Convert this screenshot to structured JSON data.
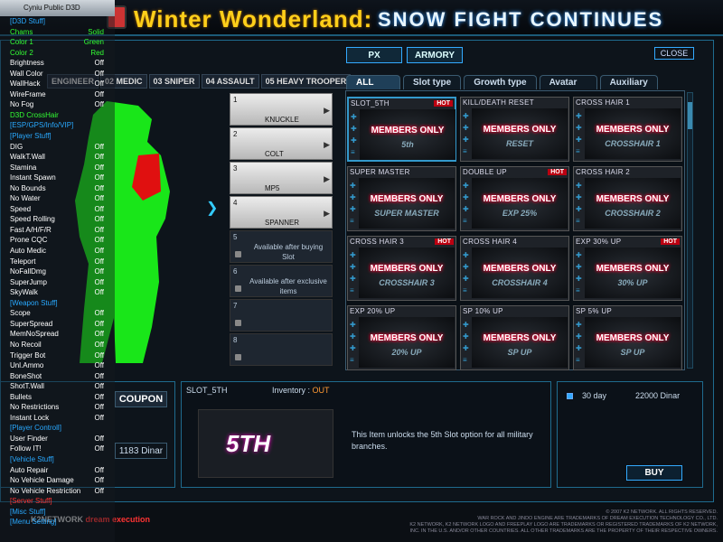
{
  "banner": {
    "title_part1": "Winter Wonderland:",
    "title_part2": "SNOW FIGHT CONTINUES"
  },
  "top": {
    "px": "PX",
    "armory": "ARMORY",
    "close": "CLOSE"
  },
  "class_tabs": [
    {
      "label": "ENGINEER"
    },
    {
      "label": "02 MEDIC"
    },
    {
      "label": "03 SNIPER"
    },
    {
      "label": "04 ASSAULT"
    },
    {
      "label": "05 HEAVY TROOPER"
    }
  ],
  "slots": [
    {
      "num": "1",
      "name": "KNUCKLE"
    },
    {
      "num": "2",
      "name": "COLT"
    },
    {
      "num": "3",
      "name": "MP5"
    },
    {
      "num": "4",
      "name": "SPANNER"
    },
    {
      "num": "5",
      "msg": "Available after buying Slot"
    },
    {
      "num": "6",
      "msg": "Available after exclusive items"
    },
    {
      "num": "7",
      "msg": ""
    },
    {
      "num": "8",
      "msg": ""
    }
  ],
  "cat_tabs": [
    "ALL",
    "Slot type",
    "Growth type",
    "Avatar",
    "Auxiliary"
  ],
  "items": [
    {
      "title": "SLOT_5TH",
      "hot": "HOT",
      "label": "MEMBERS ONLY",
      "sub": "5th"
    },
    {
      "title": "KILL/DEATH RESET",
      "hot": "",
      "label": "MEMBERS ONLY",
      "sub": "RESET"
    },
    {
      "title": "CROSS HAIR 1",
      "hot": "",
      "label": "MEMBERS ONLY",
      "sub": "CROSSHAIR 1"
    },
    {
      "title": "SUPER MASTER",
      "hot": "",
      "label": "MEMBERS ONLY",
      "sub": "SUPER MASTER"
    },
    {
      "title": "DOUBLE UP",
      "hot": "HOT",
      "label": "MEMBERS ONLY",
      "sub": "EXP 25%"
    },
    {
      "title": "CROSS HAIR 2",
      "hot": "",
      "label": "MEMBERS ONLY",
      "sub": "CROSSHAIR 2"
    },
    {
      "title": "CROSS HAIR 3",
      "hot": "HOT",
      "label": "MEMBERS ONLY",
      "sub": "CROSSHAIR 3"
    },
    {
      "title": "CROSS HAIR 4",
      "hot": "",
      "label": "MEMBERS ONLY",
      "sub": "CROSSHAIR 4"
    },
    {
      "title": "EXP 30% UP",
      "hot": "HOT",
      "label": "MEMBERS ONLY",
      "sub": "30% UP"
    },
    {
      "title": "EXP 20% UP",
      "hot": "",
      "label": "MEMBERS ONLY",
      "sub": "20% UP"
    },
    {
      "title": "SP 10% UP",
      "hot": "",
      "label": "MEMBERS ONLY",
      "sub": "SP UP"
    },
    {
      "title": "SP 5% UP",
      "hot": "",
      "label": "MEMBERS ONLY",
      "sub": "SP UP"
    }
  ],
  "bottom": {
    "coupon": "COUPON",
    "dinar": "1183 Dinar",
    "inventory_frag": "ENTORY"
  },
  "detail": {
    "name": "SLOT_5TH",
    "inventory_label": "Inventory :",
    "inventory_value": "OUT",
    "image_text": "5TH",
    "description": "This Item unlocks the 5th Slot option for all military branches."
  },
  "purchase": {
    "duration": "30 day",
    "price": "22000 Dinar",
    "buy": "BUY"
  },
  "footer": {
    "line1": "© 2007 K2 NETWORK. ALL RIGHTS RESERVED.",
    "line2": "WAR ROCK AND JINDO ENGINE ARE TRADEMARKS OF DREAM EXECUTION TECHNOLOGY CO., LTD.",
    "line3": "K2 NETWORK, K2 NETWORK LOGO AND FREEPLAY LOGO ARE TRADEMARKS OR REGISTERED TRADEMARKS OF K2 NETWORK,",
    "line4": "INC. IN THE U.S. AND/OR OTHER COUNTRIES. ALL OTHER TRADEMARKS ARE THE PROPERTY OF THEIR RESPECTIVE OWNERS.",
    "logo1": "K2NETWORK",
    "logo2": "dream execution"
  },
  "hack_menu": {
    "header": "Cyniu Public D3D",
    "items": [
      {
        "label": "[D3D Stuff]",
        "value": "",
        "color": "#29a9ff"
      },
      {
        "label": "Chams",
        "value": "Solid",
        "color": "#3f3"
      },
      {
        "label": "Color 1",
        "value": "Green",
        "color": "#3f3"
      },
      {
        "label": "Color 2",
        "value": "Red",
        "color": "#3f3"
      },
      {
        "label": "Brightness",
        "value": "Off",
        "color": "#fff"
      },
      {
        "label": "Wall Color",
        "value": "Off",
        "color": "#fff"
      },
      {
        "label": "WallHack",
        "value": "Off",
        "color": "#fff"
      },
      {
        "label": "WireFrame",
        "value": "Off",
        "color": "#fff"
      },
      {
        "label": "No Fog",
        "value": "Off",
        "color": "#fff"
      },
      {
        "label": "D3D CrossHair",
        "value": "",
        "color": "#3f3"
      },
      {
        "label": "[ESP/GPS/Info/VIP]",
        "value": "",
        "color": "#29a9ff"
      },
      {
        "label": "[Player Stuff]",
        "value": "",
        "color": "#29a9ff"
      },
      {
        "label": "DIG",
        "value": "Off",
        "color": "#fff"
      },
      {
        "label": "WalkT.Wall",
        "value": "Off",
        "color": "#fff"
      },
      {
        "label": "Stamina",
        "value": "Off",
        "color": "#fff"
      },
      {
        "label": "Instant Spawn",
        "value": "Off",
        "color": "#fff"
      },
      {
        "label": "No Bounds",
        "value": "Off",
        "color": "#fff"
      },
      {
        "label": "No Water",
        "value": "Off",
        "color": "#fff"
      },
      {
        "label": "Speed",
        "value": "Off",
        "color": "#fff"
      },
      {
        "label": "Speed Rolling",
        "value": "Off",
        "color": "#fff"
      },
      {
        "label": "Fast A/H/F/R",
        "value": "Off",
        "color": "#fff"
      },
      {
        "label": "Prone CQC",
        "value": "Off",
        "color": "#fff"
      },
      {
        "label": "Auto Medic",
        "value": "Off",
        "color": "#fff"
      },
      {
        "label": "Teleport",
        "value": "Off",
        "color": "#fff"
      },
      {
        "label": "NoFallDmg",
        "value": "Off",
        "color": "#fff"
      },
      {
        "label": "SuperJump",
        "value": "Off",
        "color": "#fff"
      },
      {
        "label": "SkyWalk",
        "value": "Off",
        "color": "#fff"
      },
      {
        "label": "[Weapon Stuff]",
        "value": "",
        "color": "#29a9ff"
      },
      {
        "label": "Scope",
        "value": "Off",
        "color": "#fff"
      },
      {
        "label": "SuperSpread",
        "value": "Off",
        "color": "#fff"
      },
      {
        "label": "MemNoSpread",
        "value": "Off",
        "color": "#fff"
      },
      {
        "label": "No Recoil",
        "value": "Off",
        "color": "#fff"
      },
      {
        "label": "Trigger Bot",
        "value": "Off",
        "color": "#fff"
      },
      {
        "label": "Unl.Ammo",
        "value": "Off",
        "color": "#fff"
      },
      {
        "label": "BoneShot",
        "value": "Off",
        "color": "#fff"
      },
      {
        "label": "ShotT.Wall",
        "value": "Off",
        "color": "#fff"
      },
      {
        "label": "Bullets",
        "value": "Off",
        "color": "#fff"
      },
      {
        "label": "No Restrictions",
        "value": "Off",
        "color": "#fff"
      },
      {
        "label": "Instant Lock",
        "value": "Off",
        "color": "#fff"
      },
      {
        "label": "[Player Controll]",
        "value": "",
        "color": "#29a9ff"
      },
      {
        "label": "User Finder",
        "value": "Off",
        "color": "#fff"
      },
      {
        "label": "Follow IT!",
        "value": "Off",
        "color": "#fff"
      },
      {
        "label": "[Vehicle Stuff]",
        "value": "",
        "color": "#29a9ff"
      },
      {
        "label": "Auto Repair",
        "value": "Off",
        "color": "#fff"
      },
      {
        "label": "No Vehicle Damage",
        "value": "Off",
        "color": "#fff"
      },
      {
        "label": "No Vehicle Restriction",
        "value": "Off",
        "color": "#fff"
      },
      {
        "label": "[Server Stuff]",
        "value": "",
        "color": "#f33"
      },
      {
        "label": "[Misc Stuff]",
        "value": "",
        "color": "#29a9ff"
      },
      {
        "label": "[Menu Setting]",
        "value": "",
        "color": "#29a9ff"
      }
    ]
  }
}
